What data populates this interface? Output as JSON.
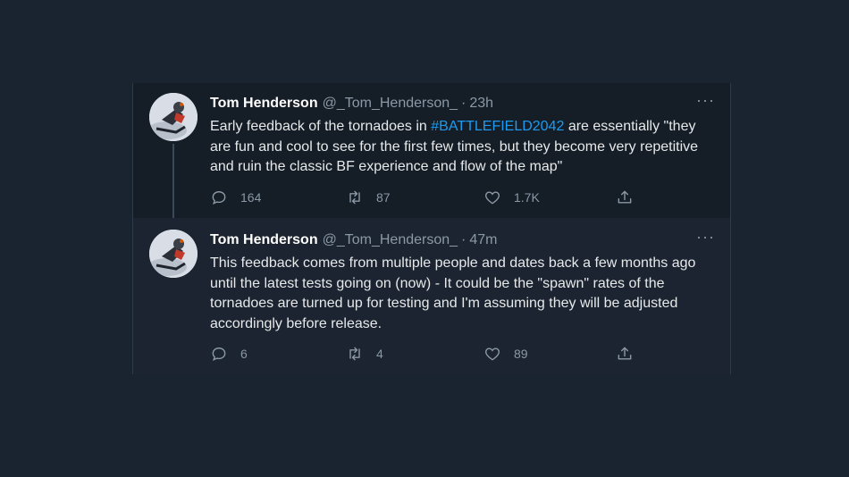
{
  "tweets": [
    {
      "author_name": "Tom Henderson",
      "handle": "@_Tom_Henderson_",
      "separator": "·",
      "time": "23h",
      "text_before": "Early feedback of the tornadoes in ",
      "hashtag": "#BATTLEFIELD2042",
      "text_after": " are essentially \"they are fun and cool to see for the first few times, but they become very repetitive and ruin the classic BF experience and flow of the map\"",
      "replies": "164",
      "retweets": "87",
      "likes": "1.7K",
      "more_label": "···"
    },
    {
      "author_name": "Tom Henderson",
      "handle": "@_Tom_Henderson_",
      "separator": "·",
      "time": "47m",
      "text": "This feedback comes from multiple people and dates back a few months ago until the latest tests going on (now) - It could be the \"spawn\" rates of the tornadoes are turned up for testing and I'm assuming they will be adjusted accordingly before release.",
      "replies": "6",
      "retweets": "4",
      "likes": "89",
      "more_label": "···"
    }
  ],
  "colors": {
    "background": "#1a2330",
    "first_tweet_bg": "#151d27",
    "hashtag": "#1d9bf0",
    "secondary_text": "#8b98a5"
  },
  "icons": [
    "reply-icon",
    "retweet-icon",
    "like-icon",
    "share-icon",
    "more-icon"
  ]
}
